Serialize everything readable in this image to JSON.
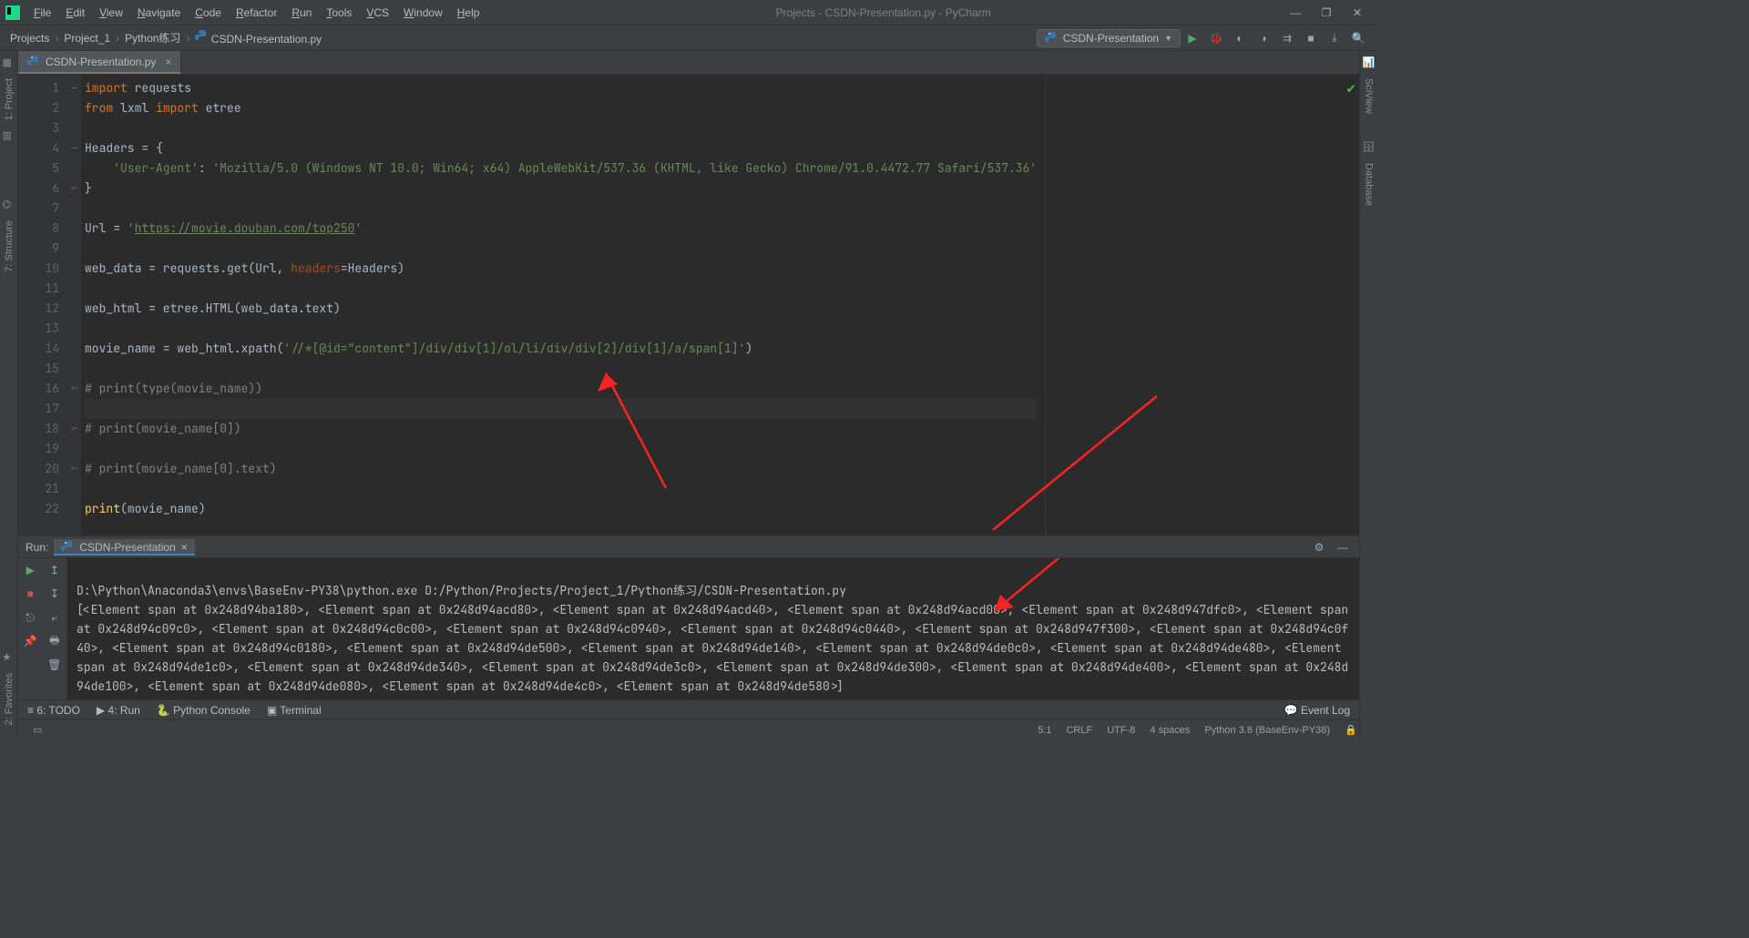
{
  "window": {
    "title": "Projects - CSDN-Presentation.py - PyCharm"
  },
  "menu": [
    "File",
    "Edit",
    "View",
    "Navigate",
    "Code",
    "Refactor",
    "Run",
    "Tools",
    "VCS",
    "Window",
    "Help"
  ],
  "breadcrumb": [
    "Projects",
    "Project_1",
    "Python练习",
    "CSDN-Presentation.py"
  ],
  "run_config": "CSDN-Presentation",
  "editor_tab": "CSDN-Presentation.py",
  "left_rail": [
    "1: Project",
    "7: Structure"
  ],
  "right_rail": [
    "SciView",
    "Database"
  ],
  "left_rail2": "2: Favorites",
  "code_lines": [
    {
      "n": 1,
      "seg": [
        {
          "c": "kw",
          "t": "import "
        },
        {
          "t": "requests"
        }
      ]
    },
    {
      "n": 2,
      "seg": [
        {
          "c": "kw",
          "t": "from "
        },
        {
          "t": "lxml "
        },
        {
          "c": "kw",
          "t": "import "
        },
        {
          "t": "etree"
        }
      ]
    },
    {
      "n": 3,
      "seg": [
        {
          "t": ""
        }
      ]
    },
    {
      "n": 4,
      "seg": [
        {
          "t": "Headers = {"
        }
      ]
    },
    {
      "n": 5,
      "seg": [
        {
          "t": "    "
        },
        {
          "c": "str",
          "t": "'User-Agent'"
        },
        {
          "t": ": "
        },
        {
          "c": "str",
          "t": "'Mozilla/5.0 (Windows NT 10.0; Win64; x64) AppleWebKit/537.36 (KHTML, like Gecko) Chrome/91.0.4472.77 Safari/537.36'"
        }
      ]
    },
    {
      "n": 6,
      "seg": [
        {
          "t": "}"
        }
      ]
    },
    {
      "n": 7,
      "seg": [
        {
          "t": ""
        }
      ]
    },
    {
      "n": 8,
      "seg": [
        {
          "t": "Url = "
        },
        {
          "c": "str",
          "t": "'"
        },
        {
          "c": "url",
          "t": "https://movie.douban.com/top250"
        },
        {
          "c": "str",
          "t": "'"
        }
      ]
    },
    {
      "n": 9,
      "seg": [
        {
          "t": ""
        }
      ]
    },
    {
      "n": 10,
      "seg": [
        {
          "t": "web_data = requests.get(Url, "
        },
        {
          "c": "arg",
          "t": "headers"
        },
        {
          "t": "=Headers)"
        }
      ]
    },
    {
      "n": 11,
      "seg": [
        {
          "t": ""
        }
      ]
    },
    {
      "n": 12,
      "seg": [
        {
          "t": "web_html = etree.HTML(web_data.text)"
        }
      ]
    },
    {
      "n": 13,
      "seg": [
        {
          "t": ""
        }
      ]
    },
    {
      "n": 14,
      "seg": [
        {
          "t": "movie_name = web_html.xpath("
        },
        {
          "c": "str",
          "t": "'//*[@id=\"content\"]/div/div[1]/ol/li/div/div[2]/div[1]/a/span[1]'"
        },
        {
          "t": ")"
        }
      ]
    },
    {
      "n": 15,
      "seg": [
        {
          "t": ""
        }
      ]
    },
    {
      "n": 16,
      "seg": [
        {
          "c": "com",
          "t": "# print(type(movie_name))"
        }
      ]
    },
    {
      "n": 17,
      "seg": [
        {
          "t": ""
        }
      ],
      "cur": true
    },
    {
      "n": 18,
      "seg": [
        {
          "c": "com",
          "t": "# print(movie_name[0])"
        }
      ]
    },
    {
      "n": 19,
      "seg": [
        {
          "t": ""
        }
      ]
    },
    {
      "n": 20,
      "seg": [
        {
          "c": "com",
          "t": "# print(movie_name[0].text)"
        }
      ]
    },
    {
      "n": 21,
      "seg": [
        {
          "t": ""
        }
      ]
    },
    {
      "n": 22,
      "seg": [
        {
          "c": "fn",
          "t": "print"
        },
        {
          "t": "(movie_name)"
        }
      ]
    }
  ],
  "fold_marks": {
    "1": "–",
    "4": "–",
    "6": "⌐",
    "16": "⌐",
    "18": "⌐",
    "20": "⌐"
  },
  "run": {
    "title": "Run:",
    "tab": "CSDN-Presentation",
    "cmd": "D:\\Python\\Anaconda3\\envs\\BaseEnv-PY38\\python.exe D:/Python/Projects/Project_1/Python练习/CSDN-Presentation.py",
    "out": "[<Element span at 0x248d94ba180>, <Element span at 0x248d94acd80>, <Element span at 0x248d94acd40>, <Element span at 0x248d94acd00>, <Element span at 0x248d947dfc0>, <Element span at 0x248d94c09c0>, <Element span at 0x248d94c0c00>, <Element span at 0x248d94c0940>, <Element span at 0x248d94c0440>, <Element span at 0x248d947f300>, <Element span at 0x248d94c0f40>, <Element span at 0x248d94c0180>, <Element span at 0x248d94de500>, <Element span at 0x248d94de140>, <Element span at 0x248d94de0c0>, <Element span at 0x248d94de480>, <Element span at 0x248d94de1c0>, <Element span at 0x248d94de340>, <Element span at 0x248d94de3c0>, <Element span at 0x248d94de300>, <Element span at 0x248d94de400>, <Element span at 0x248d94de100>, <Element span at 0x248d94de080>, <Element span at 0x248d94de4c0>, <Element span at 0x248d94de580>]"
  },
  "bottom_tabs": [
    "≡ 6: TODO",
    "▶ 4: Run",
    "🐍 Python Console",
    "▣ Terminal"
  ],
  "event_log": "Event Log",
  "status": {
    "pos": "5:1",
    "eol": "CRLF",
    "enc": "UTF-8",
    "indent": "4 spaces",
    "interp": "Python 3.8 (BaseEnv-PY38)"
  }
}
